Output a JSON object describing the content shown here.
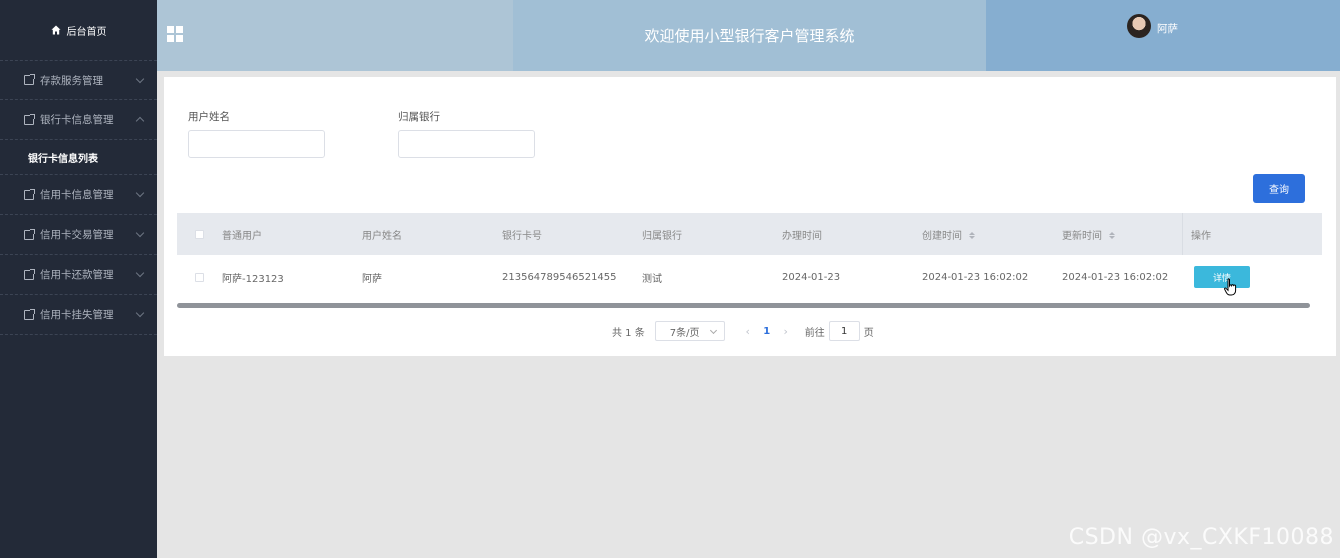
{
  "sidebar": {
    "home_label": "后台首页",
    "menus": [
      {
        "label": "存款服务管理",
        "expanded": false
      },
      {
        "label": "银行卡信息管理",
        "expanded": true,
        "children": [
          "银行卡信息列表"
        ]
      },
      {
        "label": "信用卡信息管理",
        "expanded": false
      },
      {
        "label": "信用卡交易管理",
        "expanded": false
      },
      {
        "label": "信用卡还款管理",
        "expanded": false
      },
      {
        "label": "信用卡挂失管理",
        "expanded": false
      }
    ]
  },
  "header": {
    "title": "欢迎使用小型银行客户管理系统",
    "user_name": "阿萨"
  },
  "search": {
    "username_label": "用户姓名",
    "username_value": "",
    "bank_label": "归属银行",
    "bank_value": "",
    "query_button": "查询"
  },
  "table": {
    "columns": [
      "普通用户",
      "用户姓名",
      "银行卡号",
      "归属银行",
      "办理时间",
      "创建时间",
      "更新时间",
      "操作"
    ],
    "rows": [
      {
        "user": "阿萨-123123",
        "name": "阿萨",
        "card_no": "213564789546521455",
        "bank": "测试",
        "handle_date": "2024-01-23",
        "created": "2024-01-23 16:02:02",
        "updated": "2024-01-23 16:02:02",
        "action": "详情"
      }
    ]
  },
  "pagination": {
    "total": "共 1 条",
    "page_size": "7条/页",
    "prev": "‹",
    "current": "1",
    "next": "›",
    "goto_label": "前往",
    "goto_value": "1",
    "page_suffix": "页"
  },
  "watermark": "CSDN @vx_CXKF10088",
  "colors": {
    "sidebar_bg": "#232a38",
    "header_left": "#adc5d6",
    "header_mid": "#a1bfd5",
    "header_right": "#86aed0",
    "primary": "#2d6fdc",
    "detail_button": "#3bb8dc"
  }
}
